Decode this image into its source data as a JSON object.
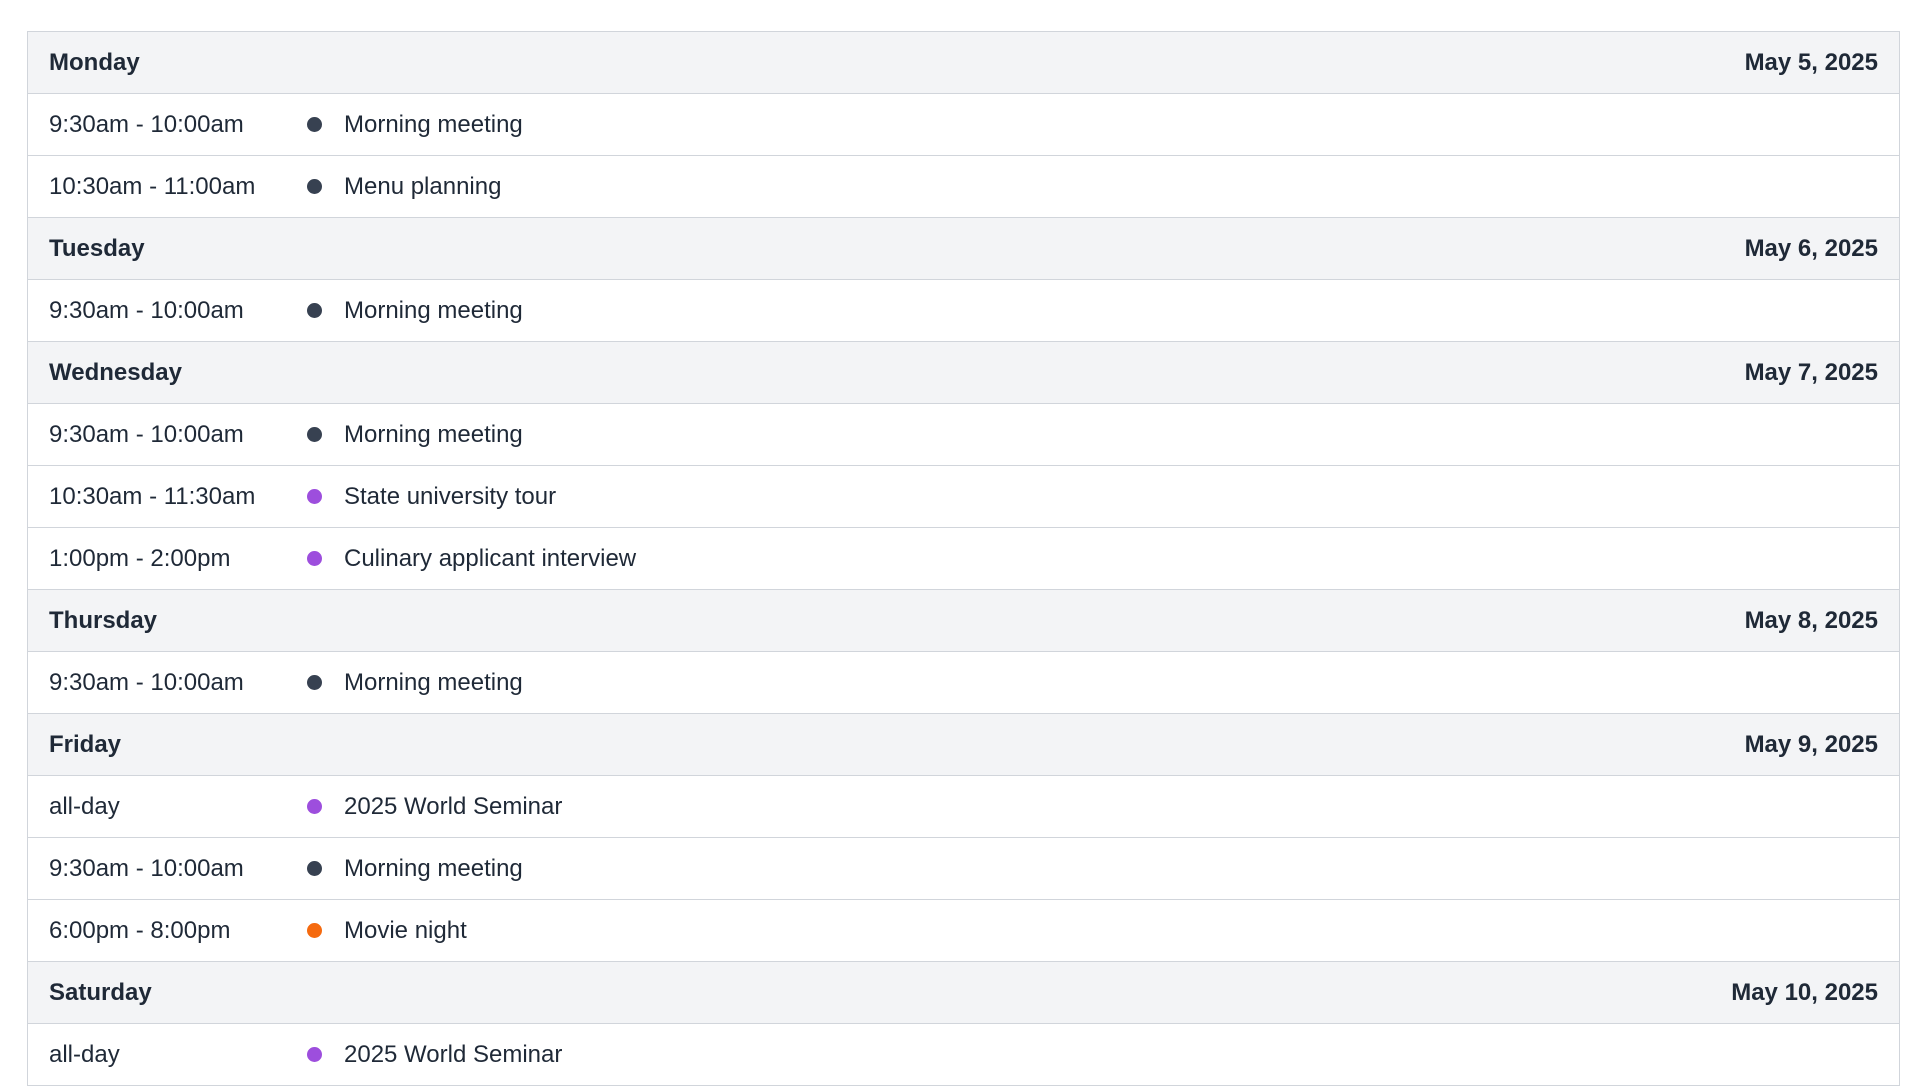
{
  "colors": {
    "default": "#374151",
    "purple": "#9d4edd",
    "orange": "#f56a0f"
  },
  "days": [
    {
      "day": "Monday",
      "date": "May 5, 2025",
      "events": [
        {
          "time": "9:30am - 10:00am",
          "title": "Morning meeting",
          "color": "#374151"
        },
        {
          "time": "10:30am - 11:00am",
          "title": "Menu planning",
          "color": "#374151"
        }
      ]
    },
    {
      "day": "Tuesday",
      "date": "May 6, 2025",
      "events": [
        {
          "time": "9:30am - 10:00am",
          "title": "Morning meeting",
          "color": "#374151"
        }
      ]
    },
    {
      "day": "Wednesday",
      "date": "May 7, 2025",
      "events": [
        {
          "time": "9:30am - 10:00am",
          "title": "Morning meeting",
          "color": "#374151"
        },
        {
          "time": "10:30am - 11:30am",
          "title": "State university tour",
          "color": "#9d4edd"
        },
        {
          "time": "1:00pm - 2:00pm",
          "title": "Culinary applicant interview",
          "color": "#9d4edd"
        }
      ]
    },
    {
      "day": "Thursday",
      "date": "May 8, 2025",
      "events": [
        {
          "time": "9:30am - 10:00am",
          "title": "Morning meeting",
          "color": "#374151"
        }
      ]
    },
    {
      "day": "Friday",
      "date": "May 9, 2025",
      "events": [
        {
          "time": "all-day",
          "title": "2025 World Seminar",
          "color": "#9d4edd"
        },
        {
          "time": "9:30am - 10:00am",
          "title": "Morning meeting",
          "color": "#374151"
        },
        {
          "time": "6:00pm - 8:00pm",
          "title": "Movie night",
          "color": "#f56a0f"
        }
      ]
    },
    {
      "day": "Saturday",
      "date": "May 10, 2025",
      "events": [
        {
          "time": "all-day",
          "title": "2025 World Seminar",
          "color": "#9d4edd"
        }
      ]
    }
  ]
}
